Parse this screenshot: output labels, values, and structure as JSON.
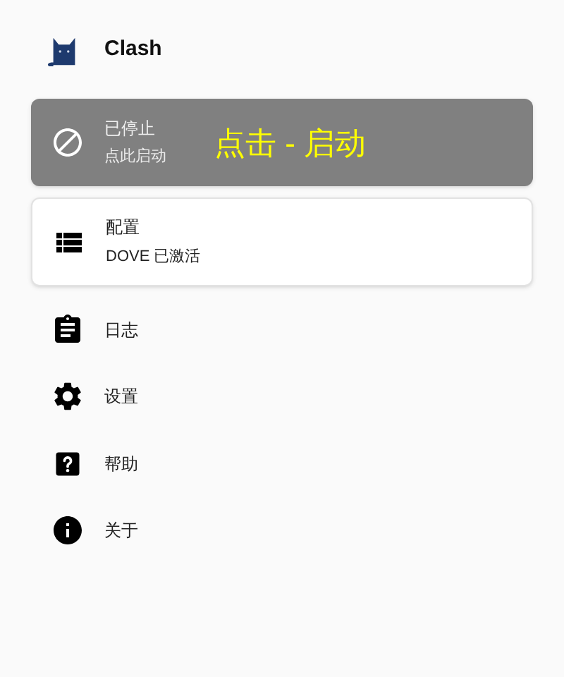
{
  "app": {
    "title": "Clash"
  },
  "status_card": {
    "kind": "stopped",
    "title": "已停止",
    "subtitle": "点此启动",
    "annotation": "点击 - 启动"
  },
  "profile_card": {
    "title": "配置",
    "subtitle": "DOVE 已激活"
  },
  "menu": [
    {
      "kind": "logs",
      "label": "日志"
    },
    {
      "kind": "settings",
      "label": "设置"
    },
    {
      "kind": "help",
      "label": "帮助"
    },
    {
      "kind": "about",
      "label": "关于"
    }
  ]
}
